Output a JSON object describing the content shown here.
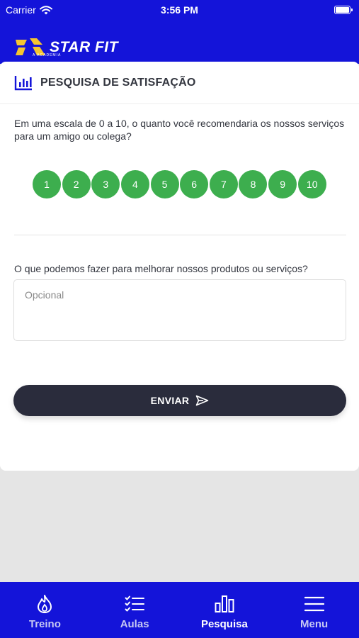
{
  "status_bar": {
    "carrier": "Carrier",
    "time": "3:56 PM"
  },
  "header": {
    "logo_text": "STAR FIT",
    "logo_subtitle": "A ACADEMIA"
  },
  "survey": {
    "title": "PESQUISA DE SATISFAÇÃO",
    "question_1": "Em uma escala de 0 a 10, o quanto você recomendaria os nossos serviços para um amigo ou colega?",
    "scale": [
      "1",
      "2",
      "3",
      "4",
      "5",
      "6",
      "7",
      "8",
      "9",
      "10"
    ],
    "question_2": "O que podemos fazer para melhorar nossos produtos ou serviços?",
    "textarea_placeholder": "Opcional",
    "submit_label": "ENVIAR"
  },
  "colors": {
    "brand": "#1414d9",
    "accent": "#3dae4e",
    "button": "#2a2c3c",
    "logo": "#f5c530"
  },
  "tabs": [
    {
      "label": "Treino",
      "icon": "flame-icon",
      "active": false
    },
    {
      "label": "Aulas",
      "icon": "checklist-icon",
      "active": false
    },
    {
      "label": "Pesquisa",
      "icon": "bar-chart-icon",
      "active": true
    },
    {
      "label": "Menu",
      "icon": "hamburger-menu-icon",
      "active": false
    }
  ]
}
